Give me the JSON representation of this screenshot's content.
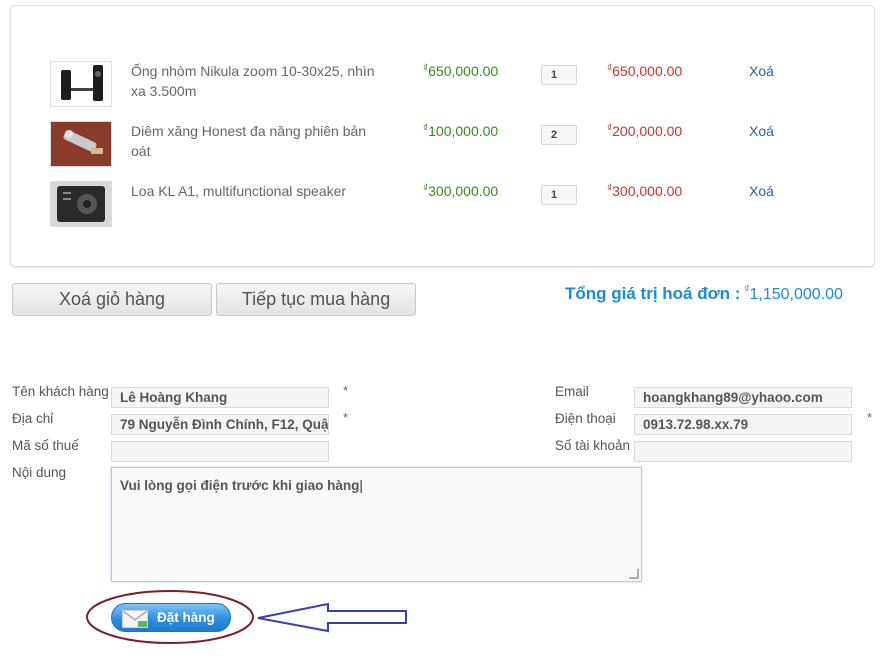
{
  "cart": {
    "items": [
      {
        "name": "Ống nhòm Nikula zoom 10-30x25, nhìn xa 3.500m",
        "price": "650,000.00",
        "qty": "1",
        "total": "650,000.00",
        "remove": "Xoá"
      },
      {
        "name": "Diêm xăng Honest đa năng phiên bản oát",
        "price": "100,000.00",
        "qty": "2",
        "total": "200,000.00",
        "remove": "Xoá"
      },
      {
        "name": "Loa KL A1, multifunctional speaker",
        "price": "300,000.00",
        "qty": "1",
        "total": "300,000.00",
        "remove": "Xoá"
      }
    ],
    "currency_symbol": "₫"
  },
  "actions": {
    "clear_cart": "Xoá giỏ hàng",
    "continue_shopping": "Tiếp tục mua hàng"
  },
  "summary": {
    "label": "Tổng giá trị hoá đơn :",
    "value": "1,150,000.00"
  },
  "form": {
    "name_label": "Tên khách hàng",
    "name_value": "Lê Hoàng Khang",
    "address_label": "Địa chỉ",
    "address_value": "79 Nguyễn Đình Chính, F12, Quậ",
    "tax_label": "Mã số thuế",
    "tax_value": "",
    "content_label": "Nội dung",
    "content_value": "Vui lòng gọi điện trước khi giao hàng",
    "email_label": "Email",
    "email_value": "hoangkhang89@yhaoo.com",
    "phone_label": "Điện thoại",
    "phone_value": "0913.72.98.xx.79",
    "account_label": "Số tài khoản",
    "account_value": "",
    "required_mark": "*"
  },
  "submit": {
    "label": "Đặt hàng"
  },
  "colors": {
    "price": "#3a8a1e",
    "line_total": "#c0392b",
    "link": "#2a5fa3",
    "accent": "#1d8ccf",
    "annotation": "#7a1f2b",
    "arrow": "#3b3fb5"
  }
}
